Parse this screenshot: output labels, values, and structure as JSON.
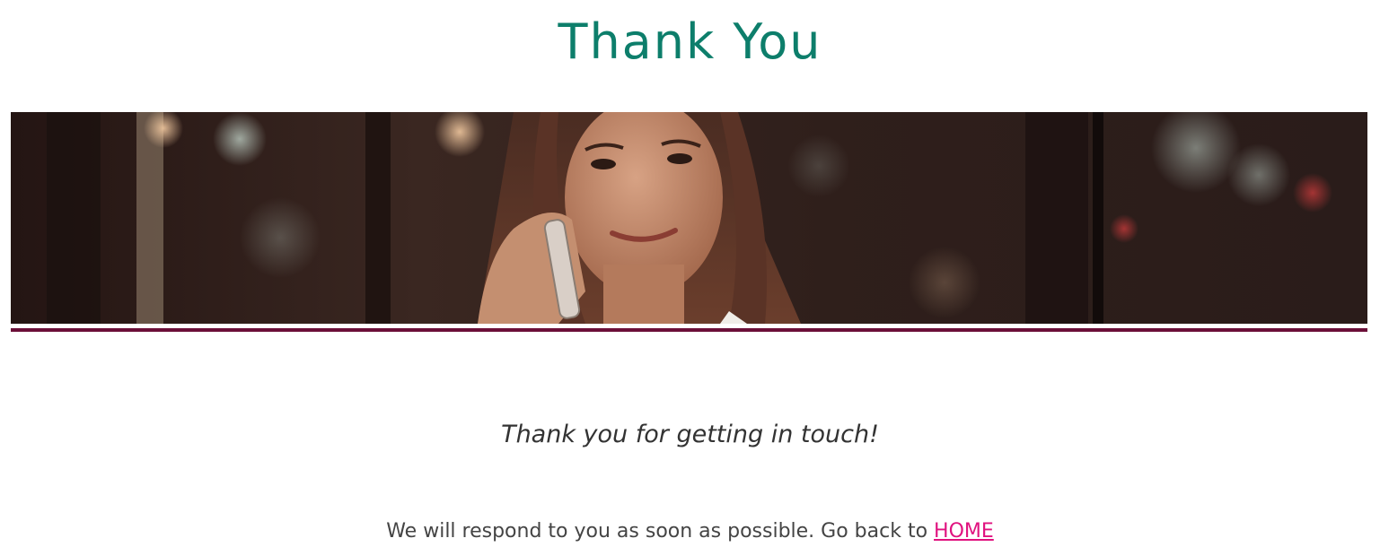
{
  "page": {
    "title": "Thank You",
    "title_color": "#0d7e6b"
  },
  "hero": {
    "image_subject": "woman-on-phone-photo",
    "rule_color": "#6b0f38"
  },
  "content": {
    "tagline": "Thank you for getting in touch!",
    "message": "We will respond to you as soon as possible. Go back to",
    "home_link_label": "HOME",
    "link_color": "#e0127f"
  }
}
